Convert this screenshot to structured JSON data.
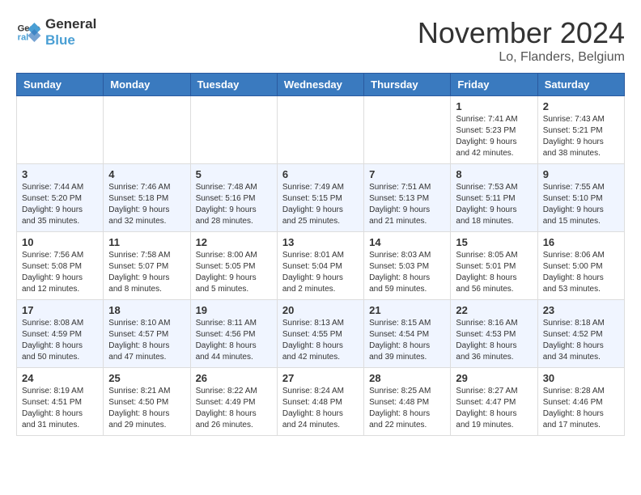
{
  "logo": {
    "line1": "General",
    "line2": "Blue"
  },
  "title": "November 2024",
  "location": "Lo, Flanders, Belgium",
  "days_of_week": [
    "Sunday",
    "Monday",
    "Tuesday",
    "Wednesday",
    "Thursday",
    "Friday",
    "Saturday"
  ],
  "weeks": [
    [
      {
        "day": "",
        "info": ""
      },
      {
        "day": "",
        "info": ""
      },
      {
        "day": "",
        "info": ""
      },
      {
        "day": "",
        "info": ""
      },
      {
        "day": "",
        "info": ""
      },
      {
        "day": "1",
        "info": "Sunrise: 7:41 AM\nSunset: 5:23 PM\nDaylight: 9 hours and 42 minutes."
      },
      {
        "day": "2",
        "info": "Sunrise: 7:43 AM\nSunset: 5:21 PM\nDaylight: 9 hours and 38 minutes."
      }
    ],
    [
      {
        "day": "3",
        "info": "Sunrise: 7:44 AM\nSunset: 5:20 PM\nDaylight: 9 hours and 35 minutes."
      },
      {
        "day": "4",
        "info": "Sunrise: 7:46 AM\nSunset: 5:18 PM\nDaylight: 9 hours and 32 minutes."
      },
      {
        "day": "5",
        "info": "Sunrise: 7:48 AM\nSunset: 5:16 PM\nDaylight: 9 hours and 28 minutes."
      },
      {
        "day": "6",
        "info": "Sunrise: 7:49 AM\nSunset: 5:15 PM\nDaylight: 9 hours and 25 minutes."
      },
      {
        "day": "7",
        "info": "Sunrise: 7:51 AM\nSunset: 5:13 PM\nDaylight: 9 hours and 21 minutes."
      },
      {
        "day": "8",
        "info": "Sunrise: 7:53 AM\nSunset: 5:11 PM\nDaylight: 9 hours and 18 minutes."
      },
      {
        "day": "9",
        "info": "Sunrise: 7:55 AM\nSunset: 5:10 PM\nDaylight: 9 hours and 15 minutes."
      }
    ],
    [
      {
        "day": "10",
        "info": "Sunrise: 7:56 AM\nSunset: 5:08 PM\nDaylight: 9 hours and 12 minutes."
      },
      {
        "day": "11",
        "info": "Sunrise: 7:58 AM\nSunset: 5:07 PM\nDaylight: 9 hours and 8 minutes."
      },
      {
        "day": "12",
        "info": "Sunrise: 8:00 AM\nSunset: 5:05 PM\nDaylight: 9 hours and 5 minutes."
      },
      {
        "day": "13",
        "info": "Sunrise: 8:01 AM\nSunset: 5:04 PM\nDaylight: 9 hours and 2 minutes."
      },
      {
        "day": "14",
        "info": "Sunrise: 8:03 AM\nSunset: 5:03 PM\nDaylight: 8 hours and 59 minutes."
      },
      {
        "day": "15",
        "info": "Sunrise: 8:05 AM\nSunset: 5:01 PM\nDaylight: 8 hours and 56 minutes."
      },
      {
        "day": "16",
        "info": "Sunrise: 8:06 AM\nSunset: 5:00 PM\nDaylight: 8 hours and 53 minutes."
      }
    ],
    [
      {
        "day": "17",
        "info": "Sunrise: 8:08 AM\nSunset: 4:59 PM\nDaylight: 8 hours and 50 minutes."
      },
      {
        "day": "18",
        "info": "Sunrise: 8:10 AM\nSunset: 4:57 PM\nDaylight: 8 hours and 47 minutes."
      },
      {
        "day": "19",
        "info": "Sunrise: 8:11 AM\nSunset: 4:56 PM\nDaylight: 8 hours and 44 minutes."
      },
      {
        "day": "20",
        "info": "Sunrise: 8:13 AM\nSunset: 4:55 PM\nDaylight: 8 hours and 42 minutes."
      },
      {
        "day": "21",
        "info": "Sunrise: 8:15 AM\nSunset: 4:54 PM\nDaylight: 8 hours and 39 minutes."
      },
      {
        "day": "22",
        "info": "Sunrise: 8:16 AM\nSunset: 4:53 PM\nDaylight: 8 hours and 36 minutes."
      },
      {
        "day": "23",
        "info": "Sunrise: 8:18 AM\nSunset: 4:52 PM\nDaylight: 8 hours and 34 minutes."
      }
    ],
    [
      {
        "day": "24",
        "info": "Sunrise: 8:19 AM\nSunset: 4:51 PM\nDaylight: 8 hours and 31 minutes."
      },
      {
        "day": "25",
        "info": "Sunrise: 8:21 AM\nSunset: 4:50 PM\nDaylight: 8 hours and 29 minutes."
      },
      {
        "day": "26",
        "info": "Sunrise: 8:22 AM\nSunset: 4:49 PM\nDaylight: 8 hours and 26 minutes."
      },
      {
        "day": "27",
        "info": "Sunrise: 8:24 AM\nSunset: 4:48 PM\nDaylight: 8 hours and 24 minutes."
      },
      {
        "day": "28",
        "info": "Sunrise: 8:25 AM\nSunset: 4:48 PM\nDaylight: 8 hours and 22 minutes."
      },
      {
        "day": "29",
        "info": "Sunrise: 8:27 AM\nSunset: 4:47 PM\nDaylight: 8 hours and 19 minutes."
      },
      {
        "day": "30",
        "info": "Sunrise: 8:28 AM\nSunset: 4:46 PM\nDaylight: 8 hours and 17 minutes."
      }
    ]
  ]
}
